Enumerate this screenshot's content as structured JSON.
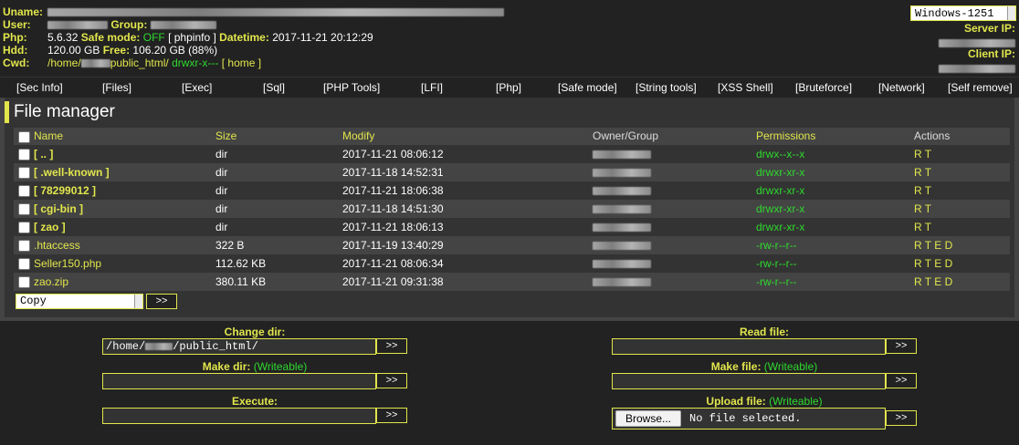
{
  "header": {
    "labels": {
      "uname": "Uname:",
      "user": "User:",
      "php": "Php:",
      "hdd": "Hdd:",
      "cwd": "Cwd:"
    },
    "group_label": "Group:",
    "php_version": "5.6.32",
    "safe_mode_label": "Safe mode:",
    "safe_mode_value": "OFF",
    "phpinfo_link": "[ phpinfo ]",
    "datetime_label": "Datetime:",
    "datetime_value": "2017-11-21 20:12:29",
    "hdd_total": "120.00 GB",
    "free_label": "Free:",
    "hdd_free": "106.20 GB (88%)",
    "cwd_prefix": "/home/",
    "cwd_suffix": "public_html/",
    "cwd_perms": "drwxr-x---",
    "home_link": "[ home ]",
    "charset": "Windows-1251",
    "server_ip_label": "Server IP:",
    "client_ip_label": "Client IP:"
  },
  "menu": [
    "[Sec Info]",
    "[Files]",
    "[Exec]",
    "[Sql]",
    "[PHP Tools]",
    "[LFI]",
    "[Php]",
    "[Safe mode]",
    "[String tools]",
    "[XSS Shell]",
    "[Bruteforce]",
    "[Network]",
    "[Self remove]"
  ],
  "file_manager": {
    "title": "File manager",
    "columns": {
      "name": "Name",
      "size": "Size",
      "modify": "Modify",
      "owner": "Owner/Group",
      "perms": "Permissions",
      "actions": "Actions"
    },
    "rows": [
      {
        "name": "[ .. ]",
        "size": "dir",
        "modify": "2017-11-21 08:06:12",
        "perms": "drwx--x--x",
        "actions": "R T",
        "is_dir": true
      },
      {
        "name": "[ .well-known ]",
        "size": "dir",
        "modify": "2017-11-18 14:52:31",
        "perms": "drwxr-xr-x",
        "actions": "R T",
        "is_dir": true
      },
      {
        "name": "[ 78299012 ]",
        "size": "dir",
        "modify": "2017-11-21 18:06:38",
        "perms": "drwxr-xr-x",
        "actions": "R T",
        "is_dir": true
      },
      {
        "name": "[ cgi-bin ]",
        "size": "dir",
        "modify": "2017-11-18 14:51:30",
        "perms": "drwxr-xr-x",
        "actions": "R T",
        "is_dir": true
      },
      {
        "name": "[ zao ]",
        "size": "dir",
        "modify": "2017-11-21 18:06:13",
        "perms": "drwxr-xr-x",
        "actions": "R T",
        "is_dir": true
      },
      {
        "name": ".htaccess",
        "size": "322 B",
        "modify": "2017-11-19 13:40:29",
        "perms": "-rw-r--r--",
        "actions": "R T E D",
        "is_dir": false
      },
      {
        "name": "Seller150.php",
        "size": "112.62 KB",
        "modify": "2017-11-21 08:06:34",
        "perms": "-rw-r--r--",
        "actions": "R T E D",
        "is_dir": false
      },
      {
        "name": "zao.zip",
        "size": "380.11 KB",
        "modify": "2017-11-21 09:31:38",
        "perms": "-rw-r--r--",
        "actions": "R T E D",
        "is_dir": false
      }
    ],
    "copy_option": "Copy",
    "go_label": ">>"
  },
  "forms": {
    "change_dir_label": "Change dir:",
    "change_dir_prefix": "/home/",
    "change_dir_suffix": "/public_html/",
    "read_file_label": "Read file:",
    "make_dir_label": "Make dir:",
    "make_file_label": "Make file:",
    "execute_label": "Execute:",
    "upload_file_label": "Upload file:",
    "writeable": "(Writeable)",
    "browse_label": "Browse...",
    "no_file": "No file selected.",
    "go_label": ">>"
  },
  "colors": {
    "accent": "#e1e64c",
    "ok": "#2ed92e",
    "bg": "#444444",
    "panel": "#222222"
  }
}
